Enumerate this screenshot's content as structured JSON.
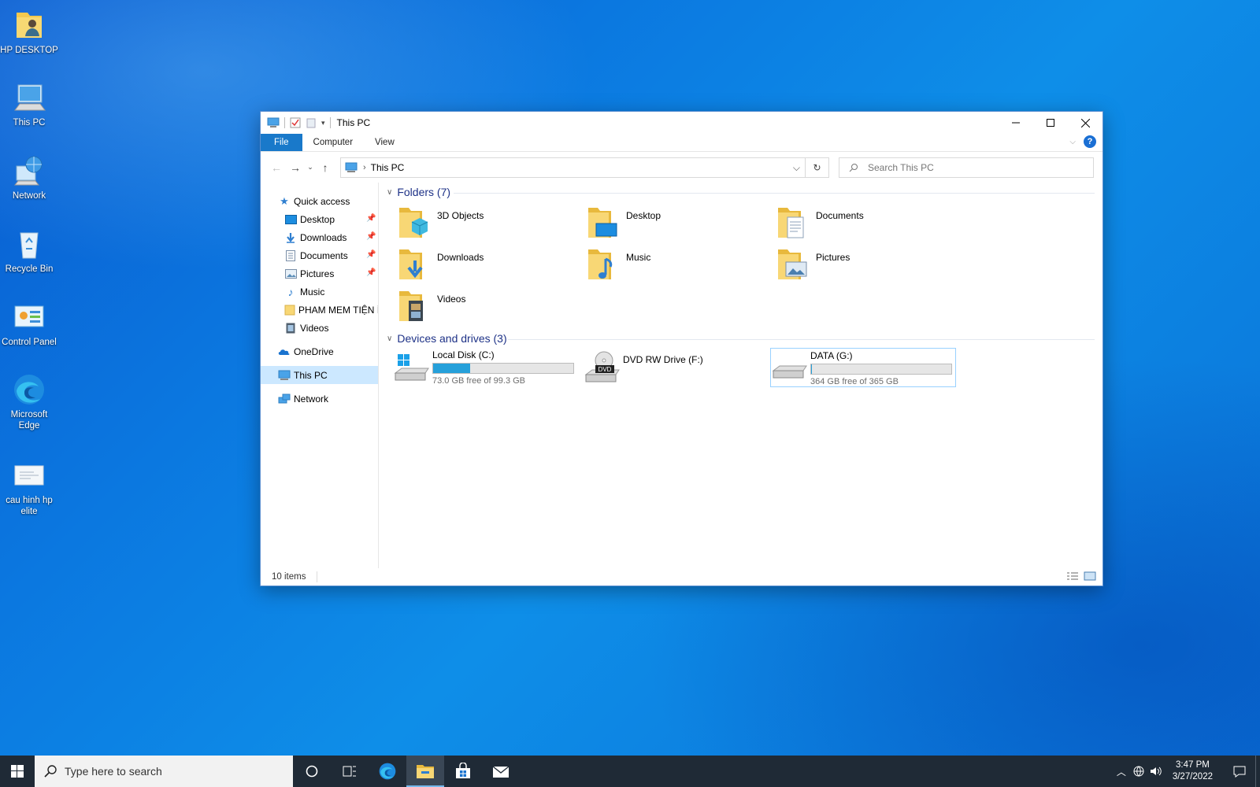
{
  "desktop": {
    "icons": [
      {
        "label": "HP DESKTOP",
        "icon": "user-folder-icon"
      },
      {
        "label": "This PC",
        "icon": "computer-icon"
      },
      {
        "label": "Network",
        "icon": "network-globe-icon"
      },
      {
        "label": "Recycle Bin",
        "icon": "recycle-bin-icon"
      },
      {
        "label": "Control Panel",
        "icon": "control-panel-icon"
      },
      {
        "label": "Microsoft Edge",
        "icon": "edge-icon"
      },
      {
        "label": "cau hinh hp elite",
        "icon": "document-icon"
      }
    ]
  },
  "window": {
    "title": "This PC",
    "ribbon_tabs": [
      "File",
      "Computer",
      "View"
    ],
    "address": {
      "path": "This PC"
    },
    "search": {
      "placeholder": "Search This PC"
    },
    "nav_pane": {
      "quick_access": "Quick access",
      "items": [
        {
          "label": "Desktop",
          "pinned": true
        },
        {
          "label": "Downloads",
          "pinned": true
        },
        {
          "label": "Documents",
          "pinned": true
        },
        {
          "label": "Pictures",
          "pinned": true
        },
        {
          "label": "Music",
          "pinned": false
        },
        {
          "label": "PHAM MEM TIỆN ÍCH",
          "pinned": false
        },
        {
          "label": "Videos",
          "pinned": false
        }
      ],
      "onedrive": "OneDrive",
      "this_pc": "This PC",
      "network": "Network"
    },
    "folders_header": "Folders (7)",
    "folders": [
      "3D Objects",
      "Desktop",
      "Documents",
      "Downloads",
      "Music",
      "Pictures",
      "Videos"
    ],
    "drives_header": "Devices and drives (3)",
    "drives": [
      {
        "name": "Local Disk (C:)",
        "free_text": "73.0 GB free of 99.3 GB",
        "used_fraction": 0.265
      },
      {
        "name": "DVD RW Drive (F:)",
        "free_text": "",
        "used_fraction": null
      },
      {
        "name": "DATA (G:)",
        "free_text": "364 GB free of 365 GB",
        "used_fraction": 0.003
      }
    ],
    "status": "10 items"
  },
  "taskbar": {
    "search_placeholder": "Type here to search",
    "time": "3:47 PM",
    "date": "3/27/2022"
  }
}
